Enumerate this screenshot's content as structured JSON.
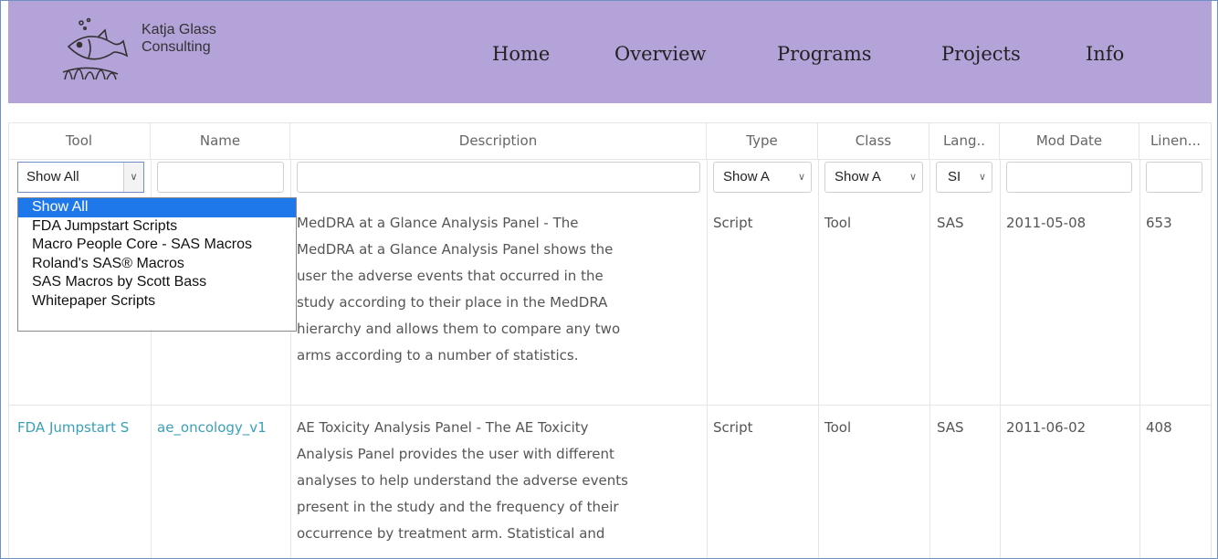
{
  "brand": {
    "line1": "Katja Glass",
    "line2": "Consulting"
  },
  "nav": [
    "Home",
    "Overview",
    "Programs",
    "Projects",
    "Info"
  ],
  "columns": [
    "Tool",
    "Name",
    "Description",
    "Type",
    "Class",
    "Lang..",
    "Mod Date",
    "Linen..."
  ],
  "filters": {
    "tool": "Show All",
    "type": "Show A",
    "class": "Show A",
    "lang": "SI"
  },
  "tool_options": [
    "Show All",
    "FDA Jumpstart Scripts",
    "Macro People Core - SAS Macros",
    "Roland's SAS® Macros",
    "SAS Macros by Scott Bass",
    "Whitepaper Scripts"
  ],
  "rows": [
    {
      "tool": "",
      "name": "",
      "description": [
        "MedDRA at a Glance Analysis Panel - The",
        "MedDRA at a Glance Analysis Panel shows the",
        "user the adverse events that occurred in the",
        "study according to their place in the MedDRA",
        "hierarchy and allows them to compare any two",
        "arms according to a number of statistics."
      ],
      "type": "Script",
      "class": "Tool",
      "lang": "SAS",
      "mod_date": "2011-05-08",
      "lines": "653"
    },
    {
      "tool": "FDA Jumpstart S",
      "name": "ae_oncology_v1",
      "description": [
        "AE Toxicity Analysis Panel - The AE Toxicity",
        "Analysis Panel provides the user with different",
        "analyses to help understand the adverse events",
        "present in the study and the frequency of their",
        "occurrence by treatment arm. Statistical and"
      ],
      "type": "Script",
      "class": "Tool",
      "lang": "SAS",
      "mod_date": "2011-06-02",
      "lines": "408"
    }
  ],
  "colors": {
    "header_bg": "#b4a3d9",
    "link": "#3aa0b8",
    "selected": "#1e78ea"
  }
}
